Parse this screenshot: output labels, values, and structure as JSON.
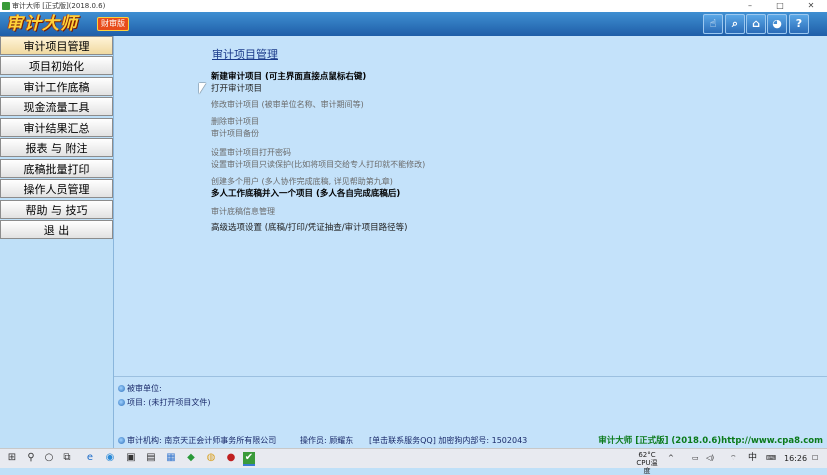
{
  "window": {
    "title": "审计大师 [正式版](2018.0.6)",
    "controls": [
      "–",
      "□",
      "✕"
    ]
  },
  "header": {
    "logo": "审计大师",
    "edition": "财审版",
    "buttons": [
      {
        "name": "hand-icon",
        "glyph": "☝"
      },
      {
        "name": "search-icon",
        "glyph": "⌕"
      },
      {
        "name": "home-icon",
        "glyph": "⌂"
      },
      {
        "name": "qq-icon",
        "glyph": "◕"
      },
      {
        "name": "help-icon",
        "glyph": "?"
      }
    ]
  },
  "sidebar": {
    "items": [
      {
        "label": "审计项目管理",
        "active": true
      },
      {
        "label": "项目初始化"
      },
      {
        "label": "审计工作底稿"
      },
      {
        "label": "现金流量工具"
      },
      {
        "label": "审计结果汇总"
      },
      {
        "label": "报表 与 附注"
      },
      {
        "label": "底稿批量打印"
      },
      {
        "label": "操作人员管理"
      },
      {
        "label": "帮助 与 技巧"
      },
      {
        "label": "退      出"
      }
    ]
  },
  "main": {
    "title": "审计项目管理",
    "links": [
      {
        "label": "新建审计项目 (可主界面直接点鼠标右键)",
        "style": "bold"
      },
      {
        "label": "打开审计项目",
        "style": "dark"
      },
      {
        "label": "修改审计项目 (被审单位名称、审计期间等)",
        "style": "gray"
      },
      {
        "label": "删除审计项目",
        "style": "gray"
      },
      {
        "label": "审计项目备份",
        "style": "gray"
      },
      {
        "label": "设置审计项目打开密码",
        "style": "gray"
      },
      {
        "label": "设置审计项目只读保护(比如将项目交给专人打印就不能修改)",
        "style": "gray"
      },
      {
        "label": "创建多个用户 (多人协作完成底稿, 详见帮助第九章)",
        "style": "gray"
      },
      {
        "label": "多人工作底稿并入一个项目 (多人各自完成底稿后)",
        "style": "bold"
      },
      {
        "label": "审计底稿信息管理",
        "style": "gray"
      },
      {
        "label": "高级选项设置 (底稿/打印/凭证抽查/审计项目路径等)",
        "style": "dark"
      }
    ]
  },
  "info": {
    "audited_unit": "被审单位:",
    "project": "项目: (未打开项目文件)"
  },
  "status": {
    "org": "审计机构: 南京天正会计师事务所有限公司",
    "operator": "操作员: 顾耀东",
    "contact": "[单击联系服务QQ] 加密狗内部号: 1502043",
    "brand": "审计大师 [正式版] (2018.0.6)http://www.cpa8.com"
  },
  "taskbar": {
    "icons": [
      {
        "name": "start-icon",
        "glyph": "⊞"
      },
      {
        "name": "search-icon",
        "glyph": "⚲"
      },
      {
        "name": "cortana-icon",
        "glyph": "○"
      },
      {
        "name": "task-view-icon",
        "glyph": "⧉"
      },
      {
        "name": "edge-icon",
        "glyph": "e"
      },
      {
        "name": "browser-icon",
        "glyph": "◉"
      },
      {
        "name": "app-icon-1",
        "glyph": "▣"
      },
      {
        "name": "app-icon-2",
        "glyph": "▤"
      },
      {
        "name": "app-icon-3",
        "glyph": "▦"
      },
      {
        "name": "app-icon-4",
        "glyph": "◆"
      },
      {
        "name": "app-icon-5",
        "glyph": "◍"
      },
      {
        "name": "app-icon-6",
        "glyph": "●"
      },
      {
        "name": "audit-app-icon",
        "glyph": "✔"
      }
    ],
    "temperature": "62°C",
    "cpu_label": "CPU温度",
    "ime": "中",
    "clock": "16:26"
  },
  "colors": {
    "header": "#1f5ea8",
    "panel": "#c4e2fa",
    "sidebar": "#bfe0f8",
    "brand_green": "#0a7a1a"
  }
}
